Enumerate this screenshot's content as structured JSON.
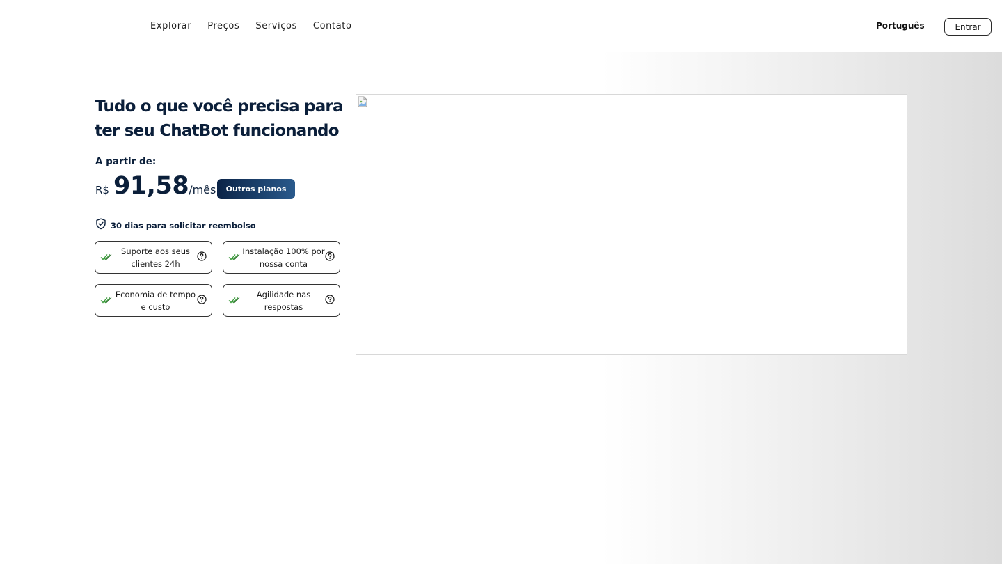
{
  "nav": {
    "items": [
      "Explorar",
      "Preços",
      "Serviços",
      "Contato"
    ],
    "language": "Português",
    "login_label": "Entrar"
  },
  "hero": {
    "title": "Tudo o que você precisa para ter seu ChatBot funcionando",
    "from_label": "A partir de:",
    "currency": "R$",
    "price": "91,58",
    "period": "/mês",
    "plans_button": "Outros planos",
    "refund_text": "30 dias para solicitar reembolso",
    "features": [
      {
        "label": "Suporte aos seus clientes 24h",
        "icon": "double-check-icon",
        "help_icon": "question-circle-icon"
      },
      {
        "label": "Instalação 100% por nossa conta",
        "icon": "double-check-icon",
        "help_icon": "question-circle-icon"
      },
      {
        "label": "Economia de tempo e custo",
        "icon": "double-check-icon",
        "help_icon": "question-circle-icon"
      },
      {
        "label": "Agilidade nas respostas",
        "icon": "double-check-icon",
        "help_icon": "question-circle-icon"
      }
    ]
  },
  "colors": {
    "primary": "#0b1f3a",
    "button_gradient_start": "#0b2347",
    "button_gradient_end": "#2a5a8c",
    "check_green": "#3a9a3a"
  }
}
